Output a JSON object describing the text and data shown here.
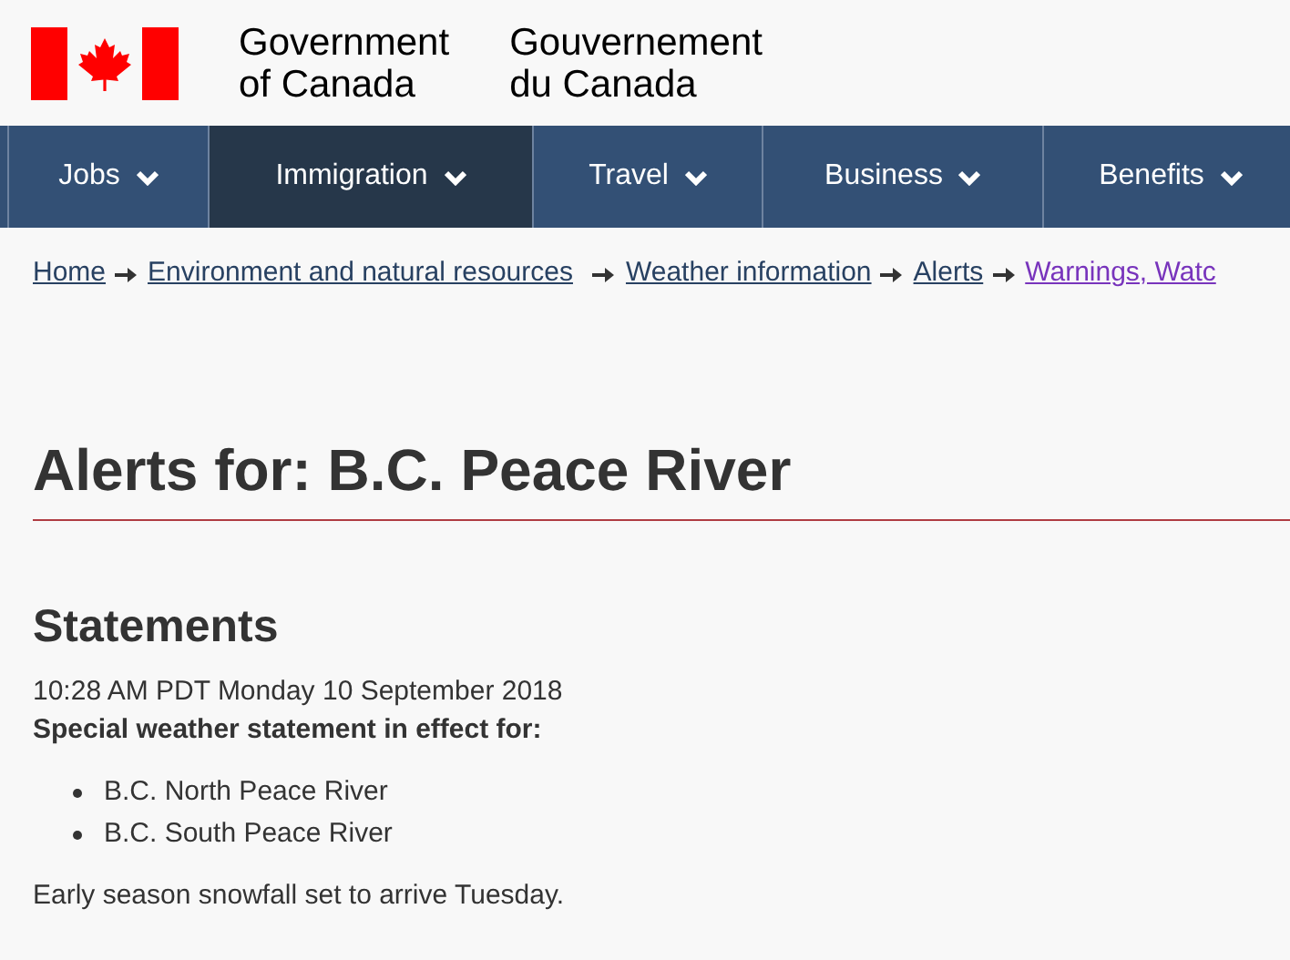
{
  "header": {
    "english": [
      "Government",
      "of Canada"
    ],
    "french": [
      "Gouvernement",
      "du Canada"
    ]
  },
  "nav": [
    {
      "label": "Jobs",
      "selected": false
    },
    {
      "label": "Immigration",
      "selected": true
    },
    {
      "label": "Travel",
      "selected": false
    },
    {
      "label": "Business",
      "selected": false
    },
    {
      "label": "Benefits",
      "selected": false
    }
  ],
  "breadcrumbs": [
    {
      "label": "Home",
      "visited": false
    },
    {
      "label": "Environment and natural resources",
      "visited": false
    },
    {
      "label": "Weather information",
      "visited": false
    },
    {
      "label": "Alerts",
      "visited": false
    },
    {
      "label": "Warnings, Watc",
      "visited": true
    }
  ],
  "title": "Alerts for: B.C. Peace River",
  "section": {
    "heading": "Statements",
    "timestamp": "10:28 AM PDT Monday 10 September 2018",
    "subheading": "Special weather statement in effect for:",
    "regions": [
      "B.C. North Peace River",
      "B.C. South Peace River"
    ],
    "summary": "Early season snowfall set to arrive Tuesday."
  }
}
